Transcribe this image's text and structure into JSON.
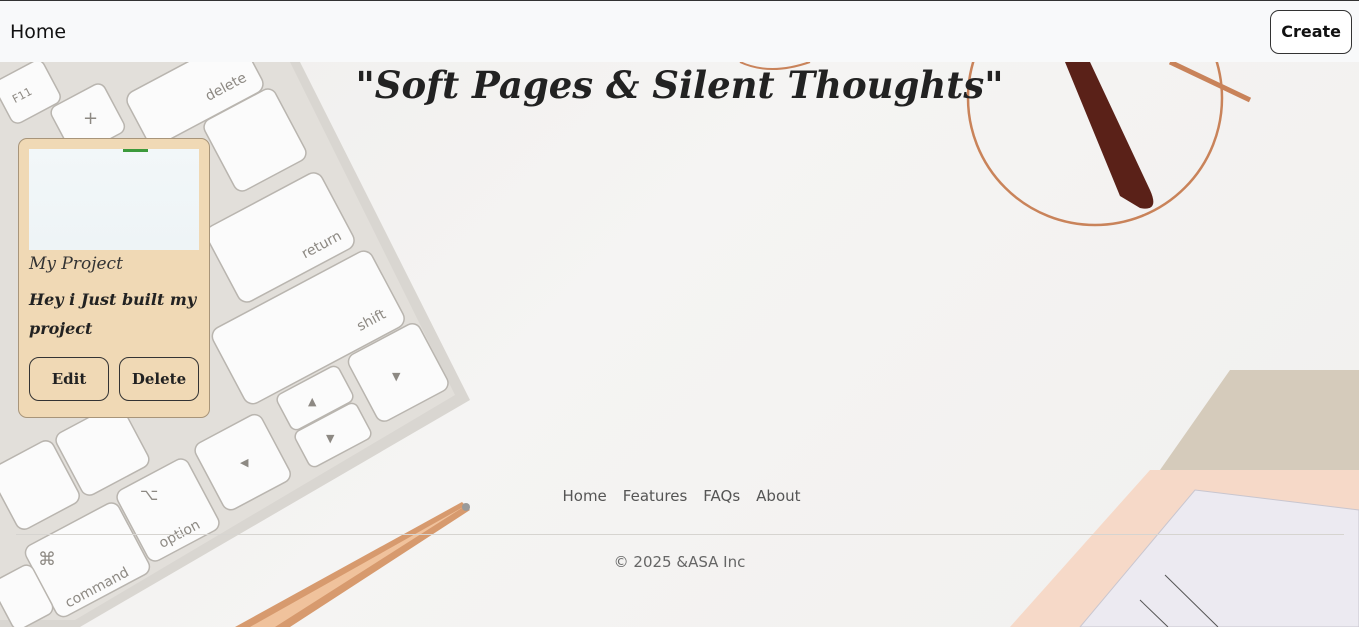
{
  "navbar": {
    "brand": "Home",
    "create_label": "Create"
  },
  "hero": {
    "title": "\"Soft Pages & Silent Thoughts\""
  },
  "note": {
    "title": "My Project",
    "body": "Hey i Just built my project",
    "edit_label": "Edit",
    "delete_label": "Delete"
  },
  "footer": {
    "links": [
      "Home",
      "Features",
      "FAQs",
      "About"
    ],
    "copyright": "© 2025 &ASA Inc"
  },
  "colors": {
    "card": "#f0d9b5",
    "navbar": "#f8f9fa"
  },
  "background": {
    "keys": [
      "delete",
      "F11",
      "return",
      "shift",
      "option",
      "command",
      "+"
    ]
  }
}
